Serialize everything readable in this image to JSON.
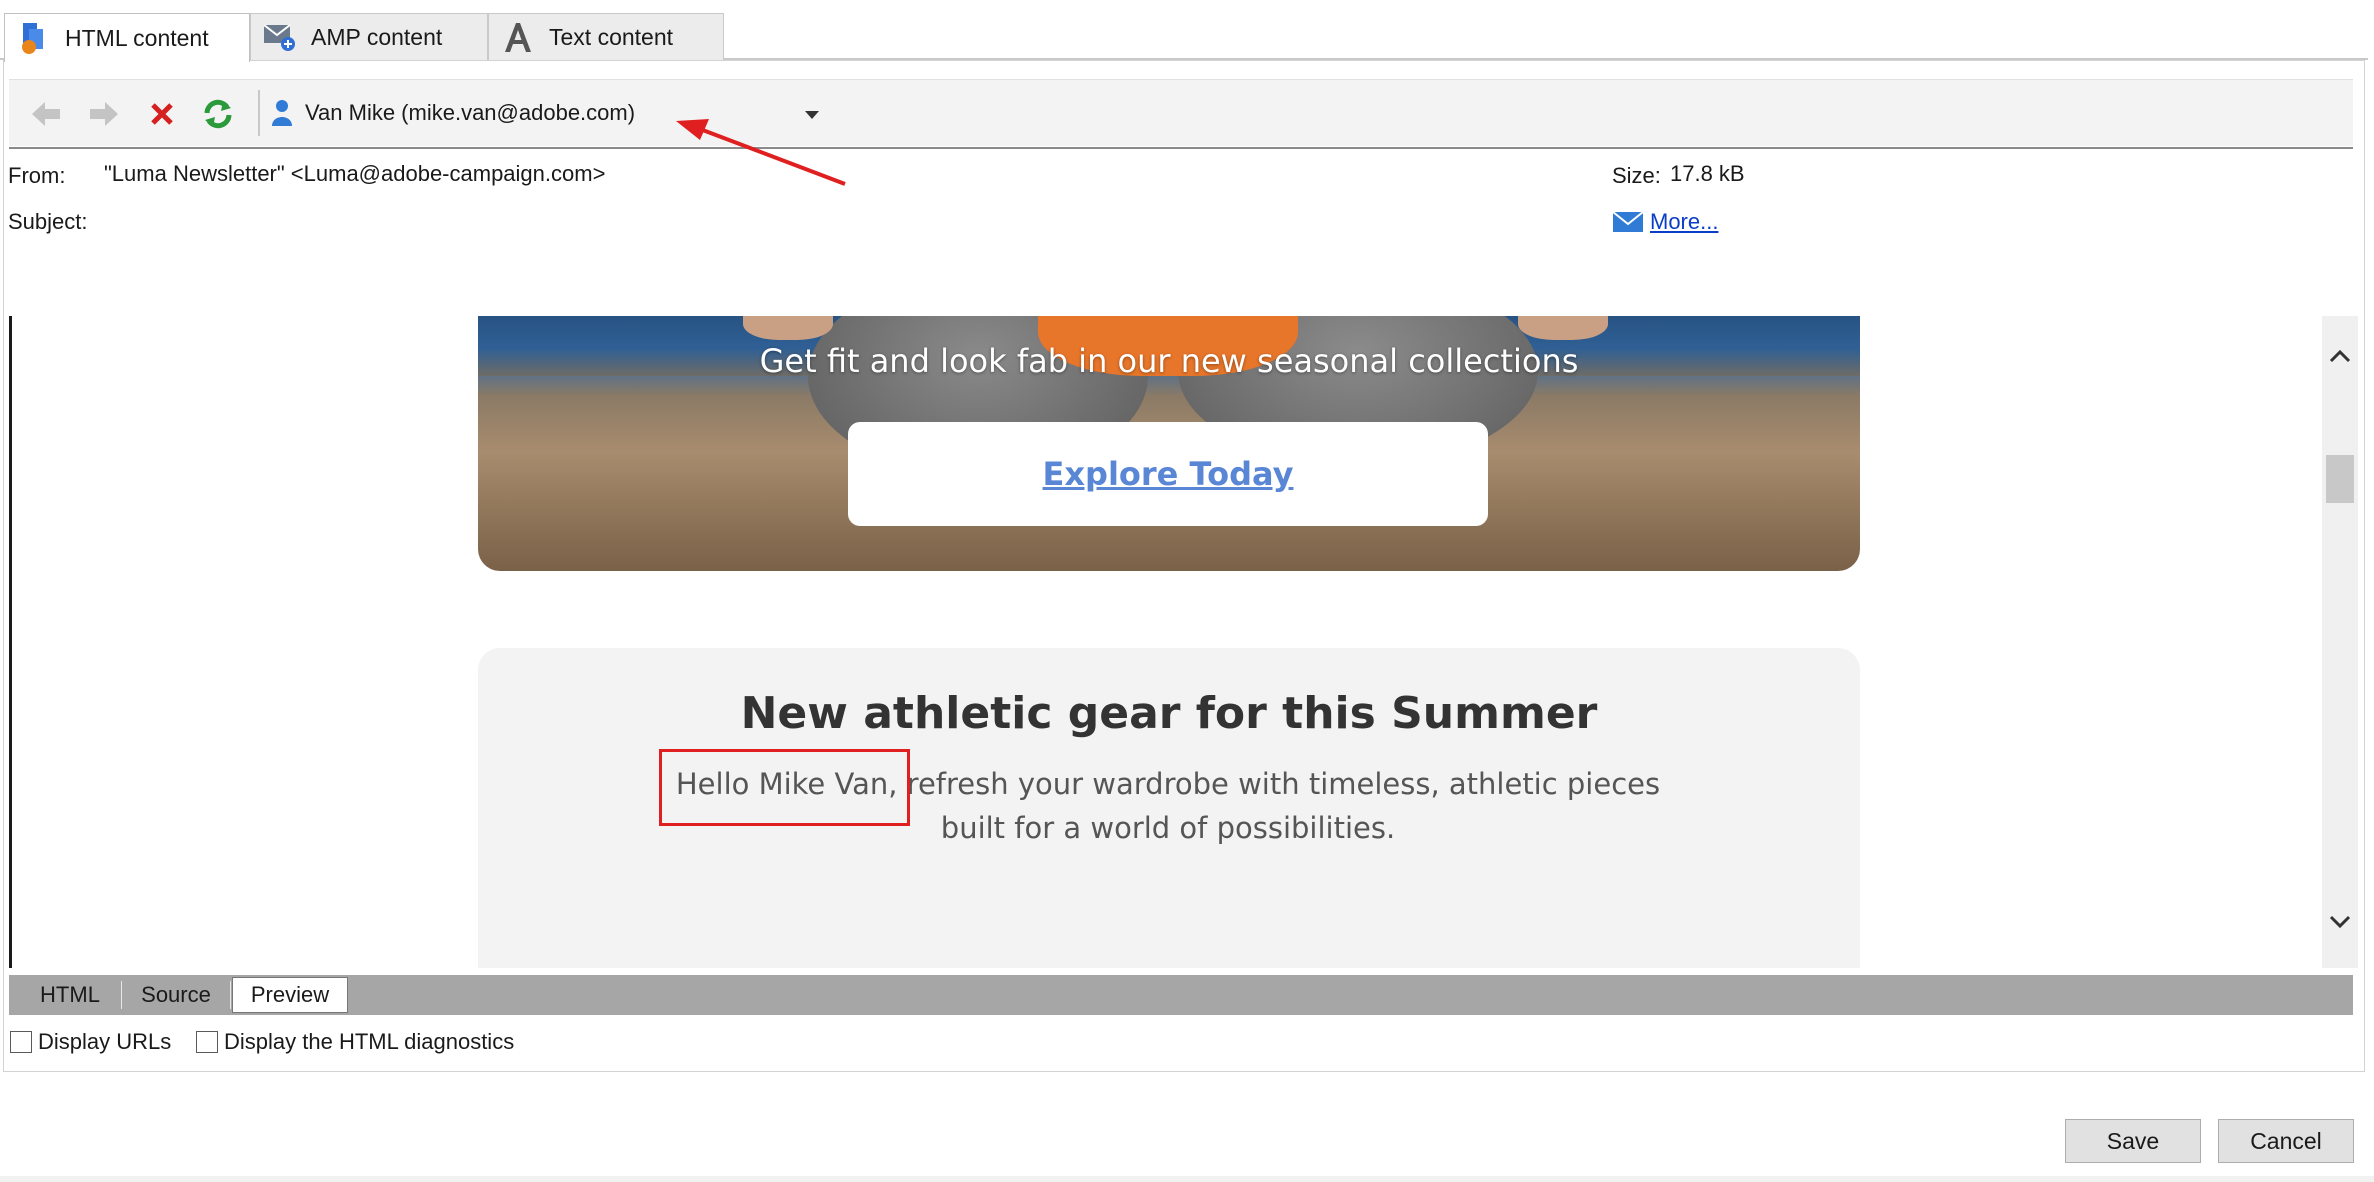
{
  "top_tabs": [
    {
      "label": "HTML content",
      "icon": "html-content-icon"
    },
    {
      "label": "AMP content",
      "icon": "amp-content-icon"
    },
    {
      "label": "Text content",
      "icon": "text-content-icon"
    }
  ],
  "toolbar": {
    "recipient": "Van Mike (mike.van@adobe.com)",
    "buttons": [
      "back-icon",
      "forward-icon",
      "delete-icon",
      "refresh-icon"
    ]
  },
  "header": {
    "from_label": "From:",
    "from_value": "\"Luma Newsletter\" <Luma@adobe-campaign.com>",
    "subject_label": "Subject:",
    "size_label": "Size:",
    "size_value": "17.8 kB",
    "more_label": "More..."
  },
  "preview": {
    "hero_text": "Get fit and look fab in our new seasonal collections",
    "hero_button": "Explore Today",
    "card_title": "New athletic gear for this Summer",
    "card_body_line1": "Hello Mike Van, refresh your wardrobe with timeless, athletic pieces",
    "card_body_line2": "built for a world of possibilities."
  },
  "bottom_tabs": [
    "HTML",
    "Source",
    "Preview"
  ],
  "checkboxes": [
    "Display URLs",
    "Display the HTML diagnostics"
  ],
  "footer": {
    "save": "Save",
    "cancel": "Cancel"
  },
  "colors": {
    "annotation_red": "#e02020",
    "link_blue": "#0a3ec9",
    "button_link": "#5a86d6"
  }
}
